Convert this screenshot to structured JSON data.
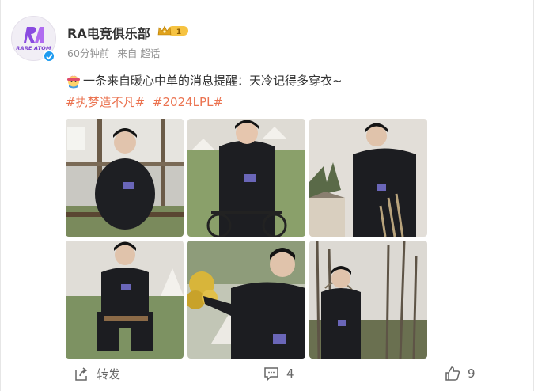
{
  "post": {
    "author": "RA电竞俱乐部",
    "avatar_logo_text": "RARE ATOM",
    "time": "60分钟前",
    "source": "来自 超话",
    "text": "一条来自暖心中单的消息提醒：天冷记得多穿衣~",
    "hashtags": [
      "#执梦造不凡#",
      "#2024LPL#"
    ]
  },
  "photos": [
    {
      "alt": "man sitting on bench outdoors"
    },
    {
      "alt": "man on bicycle at campsite"
    },
    {
      "alt": "man standing near building"
    },
    {
      "alt": "man sitting on chair near tents"
    },
    {
      "alt": "man reaching for flowers"
    },
    {
      "alt": "man standing among trees"
    }
  ],
  "actions": {
    "repost": "转发",
    "comments": "4",
    "likes": "9"
  },
  "colors": {
    "accent": "#eb7350",
    "verified": "#1d9bf0",
    "brand_purple": "#7a3fd0"
  }
}
